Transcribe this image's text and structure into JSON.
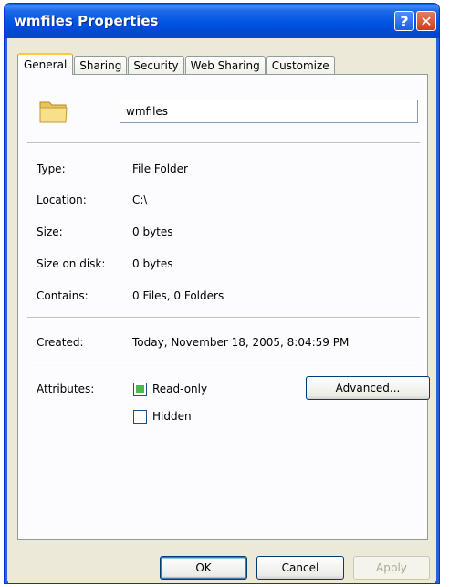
{
  "window": {
    "title": "wmfiles Properties"
  },
  "titlebar": {
    "help_glyph": "?",
    "close_glyph": "✕"
  },
  "tabs": [
    {
      "label": "General",
      "active": true
    },
    {
      "label": "Sharing",
      "active": false
    },
    {
      "label": "Security",
      "active": false
    },
    {
      "label": "Web Sharing",
      "active": false
    },
    {
      "label": "Customize",
      "active": false
    }
  ],
  "general": {
    "name_value": "wmfiles",
    "folder_icon": "folder-icon",
    "fields": [
      {
        "label": "Type:",
        "value": "File Folder"
      },
      {
        "label": "Location:",
        "value": "C:\\"
      },
      {
        "label": "Size:",
        "value": "0 bytes"
      },
      {
        "label": "Size on disk:",
        "value": "0 bytes"
      },
      {
        "label": "Contains:",
        "value": "0 Files, 0 Folders"
      }
    ],
    "created": {
      "label": "Created:",
      "value": "Today, November 18, 2005, 8:04:59 PM"
    },
    "attributes": {
      "label": "Attributes:",
      "readonly_label": "Read-only",
      "readonly_state": "indeterminate",
      "hidden_label": "Hidden",
      "hidden_checked": false,
      "advanced_label": "Advanced..."
    }
  },
  "footer": {
    "ok_label": "OK",
    "cancel_label": "Cancel",
    "apply_label": "Apply"
  },
  "colors": {
    "title_bar": "#0054e3",
    "dialog_bg": "#ece9d8",
    "tab_highlight": "#ffc73c",
    "close_button": "#c8401f"
  }
}
